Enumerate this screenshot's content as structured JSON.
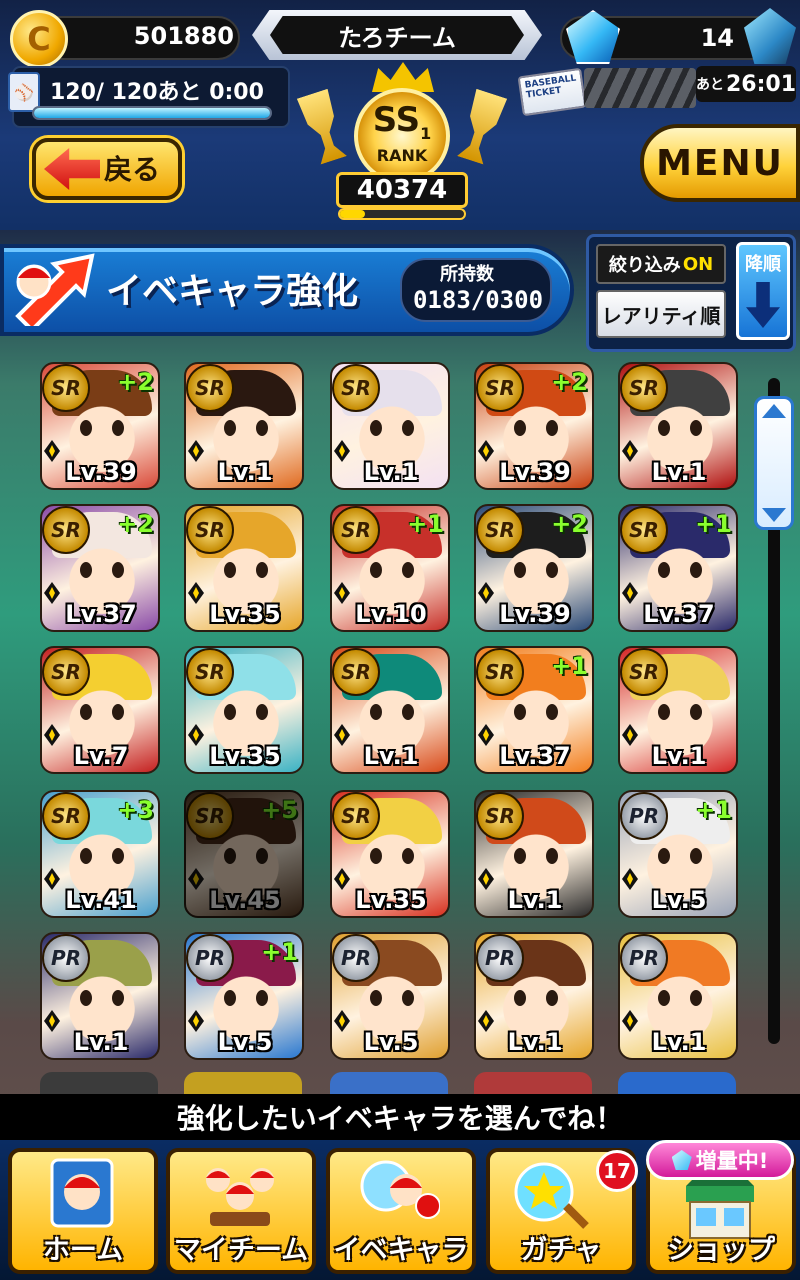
{
  "header": {
    "coins": "501880",
    "coin_icon_letter": "C",
    "team_name": "たろチーム",
    "gems": "14",
    "stamina": "120/ 120あと 0:00",
    "stamina_fraction": 1.0,
    "ticket_label": "BASEBALL TICKET",
    "ticket_time_prefix": "あと",
    "ticket_time": "26:01",
    "back_label": "戻る",
    "rank": "SS",
    "rank_sub": "1",
    "rank_word": "RANK",
    "rank_score": "40374",
    "rank_progress": 0.2,
    "menu_label": "MENU"
  },
  "section": {
    "title": "イベキャラ強化",
    "owned_label": "所持数",
    "owned_value": "0183/0300",
    "filter_label": "絞り込み",
    "filter_state": "ON",
    "sort_rarity": "レアリティ順",
    "sort_order": "降順"
  },
  "cards": [
    {
      "rarity": "SR",
      "plus": "+2",
      "level": "Lv.39",
      "hair": "#7a3d16",
      "bg": "#d94a3a"
    },
    {
      "rarity": "SR",
      "plus": "",
      "level": "Lv.1",
      "hair": "#2a1810",
      "bg": "#e06a20"
    },
    {
      "rarity": "SR",
      "plus": "",
      "level": "Lv.1",
      "hair": "#e6e0ec",
      "bg": "#f3e1f2"
    },
    {
      "rarity": "SR",
      "plus": "+2",
      "level": "Lv.39",
      "hair": "#d04a14",
      "bg": "#c94010"
    },
    {
      "rarity": "SR",
      "plus": "",
      "level": "Lv.1",
      "hair": "#404040",
      "bg": "#b01010"
    },
    {
      "rarity": "SR",
      "plus": "+2",
      "level": "Lv.37",
      "hair": "#f3e7e0",
      "bg": "#8a4ba8"
    },
    {
      "rarity": "SR",
      "plus": "",
      "level": "Lv.35",
      "hair": "#e6a62a",
      "bg": "#e6a62a"
    },
    {
      "rarity": "SR",
      "plus": "+1",
      "level": "Lv.10",
      "hair": "#c7302a",
      "bg": "#c7302a"
    },
    {
      "rarity": "SR",
      "plus": "+2",
      "level": "Lv.39",
      "hair": "#1d1d1d",
      "bg": "#2a4a78"
    },
    {
      "rarity": "SR",
      "plus": "+1",
      "level": "Lv.37",
      "hair": "#2a2a6a",
      "bg": "#2a2a6a"
    },
    {
      "rarity": "SR",
      "plus": "",
      "level": "Lv.7",
      "hair": "#f4cf30",
      "bg": "#c42020"
    },
    {
      "rarity": "SR",
      "plus": "",
      "level": "Lv.35",
      "hair": "#8fe0e8",
      "bg": "#3ab2c4"
    },
    {
      "rarity": "SR",
      "plus": "",
      "level": "Lv.1",
      "hair": "#0e8a7a",
      "bg": "#d84a1a"
    },
    {
      "rarity": "SR",
      "plus": "+1",
      "level": "Lv.37",
      "hair": "#f27e1e",
      "bg": "#f27e1e"
    },
    {
      "rarity": "SR",
      "plus": "",
      "level": "Lv.1",
      "hair": "#f0d05a",
      "bg": "#d42626"
    },
    {
      "rarity": "SR",
      "plus": "+3",
      "level": "Lv.41",
      "hair": "#7ad8dc",
      "bg": "#4aa0ce"
    },
    {
      "rarity": "SR",
      "plus": "+5",
      "level": "Lv.45",
      "hair": "#4a2a18",
      "bg": "#5a3a20",
      "dim": true
    },
    {
      "rarity": "SR",
      "plus": "",
      "level": "Lv.35",
      "hair": "#f2d044",
      "bg": "#d83020"
    },
    {
      "rarity": "SR",
      "plus": "",
      "level": "Lv.1",
      "hair": "#d04a1a",
      "bg": "#2a2a2a"
    },
    {
      "rarity": "PR",
      "plus": "+1",
      "level": "Lv.5",
      "hair": "#eeeeee",
      "bg": "#9aa4b8"
    },
    {
      "rarity": "PR",
      "plus": "",
      "level": "Lv.1",
      "hair": "#9aa04a",
      "bg": "#2a2a6a"
    },
    {
      "rarity": "PR",
      "plus": "+1",
      "level": "Lv.5",
      "hair": "#8a1a4a",
      "bg": "#2a78d0"
    },
    {
      "rarity": "PR",
      "plus": "",
      "level": "Lv.5",
      "hair": "#8a4a20",
      "bg": "#e0a030"
    },
    {
      "rarity": "PR",
      "plus": "",
      "level": "Lv.1",
      "hair": "#6a3418",
      "bg": "#e6a62a"
    },
    {
      "rarity": "PR",
      "plus": "",
      "level": "Lv.1",
      "hair": "#f07a24",
      "bg": "#e8c040"
    }
  ],
  "hint": "強化したいイベキャラを選んでね！",
  "nav": {
    "home": "ホーム",
    "myteam": "マイチーム",
    "evechara": "イベキャラ",
    "gacha": "ガチャ",
    "gacha_badge": "17",
    "shop": "ショップ",
    "shop_badge": "増量中!"
  },
  "colors": {
    "accent_blue": "#1a7fd6",
    "gold": "#ffcc33",
    "plus_green": "#8aff2e"
  }
}
